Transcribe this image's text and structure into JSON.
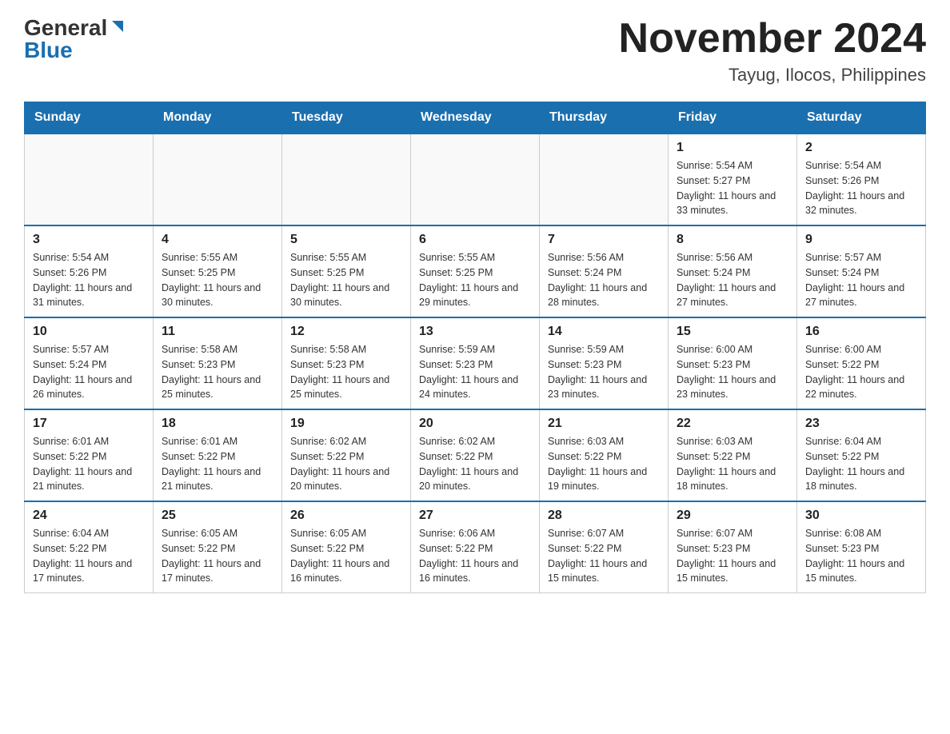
{
  "header": {
    "logo_general": "General",
    "logo_blue": "Blue",
    "month_title": "November 2024",
    "location": "Tayug, Ilocos, Philippines"
  },
  "days_of_week": [
    "Sunday",
    "Monday",
    "Tuesday",
    "Wednesday",
    "Thursday",
    "Friday",
    "Saturday"
  ],
  "weeks": [
    [
      {
        "day": "",
        "info": ""
      },
      {
        "day": "",
        "info": ""
      },
      {
        "day": "",
        "info": ""
      },
      {
        "day": "",
        "info": ""
      },
      {
        "day": "",
        "info": ""
      },
      {
        "day": "1",
        "info": "Sunrise: 5:54 AM\nSunset: 5:27 PM\nDaylight: 11 hours and 33 minutes."
      },
      {
        "day": "2",
        "info": "Sunrise: 5:54 AM\nSunset: 5:26 PM\nDaylight: 11 hours and 32 minutes."
      }
    ],
    [
      {
        "day": "3",
        "info": "Sunrise: 5:54 AM\nSunset: 5:26 PM\nDaylight: 11 hours and 31 minutes."
      },
      {
        "day": "4",
        "info": "Sunrise: 5:55 AM\nSunset: 5:25 PM\nDaylight: 11 hours and 30 minutes."
      },
      {
        "day": "5",
        "info": "Sunrise: 5:55 AM\nSunset: 5:25 PM\nDaylight: 11 hours and 30 minutes."
      },
      {
        "day": "6",
        "info": "Sunrise: 5:55 AM\nSunset: 5:25 PM\nDaylight: 11 hours and 29 minutes."
      },
      {
        "day": "7",
        "info": "Sunrise: 5:56 AM\nSunset: 5:24 PM\nDaylight: 11 hours and 28 minutes."
      },
      {
        "day": "8",
        "info": "Sunrise: 5:56 AM\nSunset: 5:24 PM\nDaylight: 11 hours and 27 minutes."
      },
      {
        "day": "9",
        "info": "Sunrise: 5:57 AM\nSunset: 5:24 PM\nDaylight: 11 hours and 27 minutes."
      }
    ],
    [
      {
        "day": "10",
        "info": "Sunrise: 5:57 AM\nSunset: 5:24 PM\nDaylight: 11 hours and 26 minutes."
      },
      {
        "day": "11",
        "info": "Sunrise: 5:58 AM\nSunset: 5:23 PM\nDaylight: 11 hours and 25 minutes."
      },
      {
        "day": "12",
        "info": "Sunrise: 5:58 AM\nSunset: 5:23 PM\nDaylight: 11 hours and 25 minutes."
      },
      {
        "day": "13",
        "info": "Sunrise: 5:59 AM\nSunset: 5:23 PM\nDaylight: 11 hours and 24 minutes."
      },
      {
        "day": "14",
        "info": "Sunrise: 5:59 AM\nSunset: 5:23 PM\nDaylight: 11 hours and 23 minutes."
      },
      {
        "day": "15",
        "info": "Sunrise: 6:00 AM\nSunset: 5:23 PM\nDaylight: 11 hours and 23 minutes."
      },
      {
        "day": "16",
        "info": "Sunrise: 6:00 AM\nSunset: 5:22 PM\nDaylight: 11 hours and 22 minutes."
      }
    ],
    [
      {
        "day": "17",
        "info": "Sunrise: 6:01 AM\nSunset: 5:22 PM\nDaylight: 11 hours and 21 minutes."
      },
      {
        "day": "18",
        "info": "Sunrise: 6:01 AM\nSunset: 5:22 PM\nDaylight: 11 hours and 21 minutes."
      },
      {
        "day": "19",
        "info": "Sunrise: 6:02 AM\nSunset: 5:22 PM\nDaylight: 11 hours and 20 minutes."
      },
      {
        "day": "20",
        "info": "Sunrise: 6:02 AM\nSunset: 5:22 PM\nDaylight: 11 hours and 20 minutes."
      },
      {
        "day": "21",
        "info": "Sunrise: 6:03 AM\nSunset: 5:22 PM\nDaylight: 11 hours and 19 minutes."
      },
      {
        "day": "22",
        "info": "Sunrise: 6:03 AM\nSunset: 5:22 PM\nDaylight: 11 hours and 18 minutes."
      },
      {
        "day": "23",
        "info": "Sunrise: 6:04 AM\nSunset: 5:22 PM\nDaylight: 11 hours and 18 minutes."
      }
    ],
    [
      {
        "day": "24",
        "info": "Sunrise: 6:04 AM\nSunset: 5:22 PM\nDaylight: 11 hours and 17 minutes."
      },
      {
        "day": "25",
        "info": "Sunrise: 6:05 AM\nSunset: 5:22 PM\nDaylight: 11 hours and 17 minutes."
      },
      {
        "day": "26",
        "info": "Sunrise: 6:05 AM\nSunset: 5:22 PM\nDaylight: 11 hours and 16 minutes."
      },
      {
        "day": "27",
        "info": "Sunrise: 6:06 AM\nSunset: 5:22 PM\nDaylight: 11 hours and 16 minutes."
      },
      {
        "day": "28",
        "info": "Sunrise: 6:07 AM\nSunset: 5:22 PM\nDaylight: 11 hours and 15 minutes."
      },
      {
        "day": "29",
        "info": "Sunrise: 6:07 AM\nSunset: 5:23 PM\nDaylight: 11 hours and 15 minutes."
      },
      {
        "day": "30",
        "info": "Sunrise: 6:08 AM\nSunset: 5:23 PM\nDaylight: 11 hours and 15 minutes."
      }
    ]
  ]
}
